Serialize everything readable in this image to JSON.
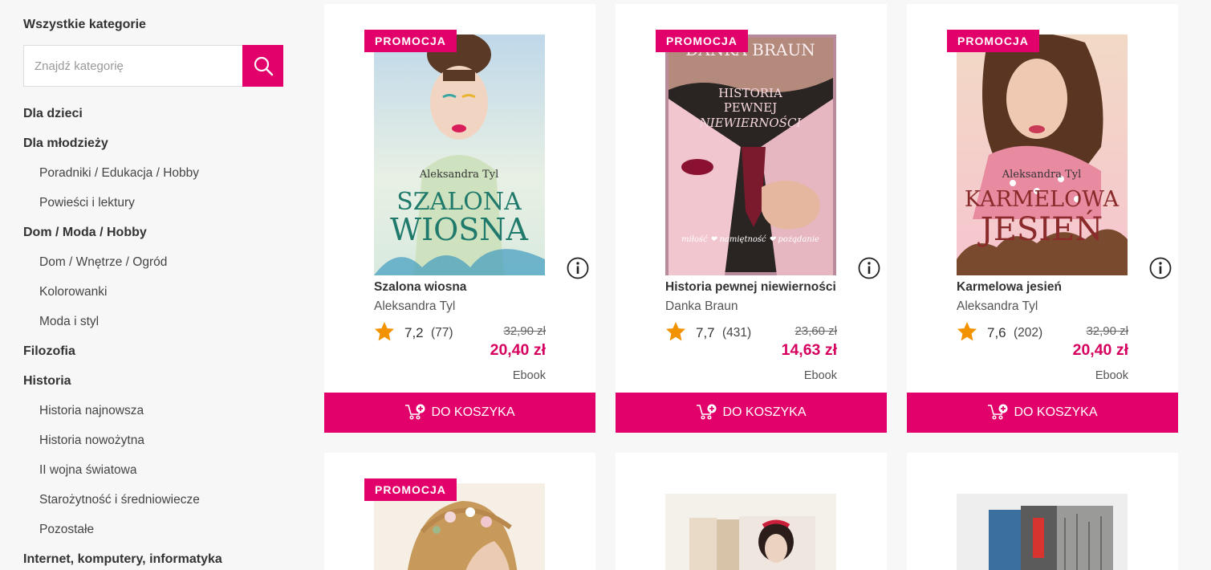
{
  "sidebar": {
    "title": "Wszystkie kategorie",
    "search_placeholder": "Znajdź kategorię",
    "categories": [
      {
        "label": "Dla dzieci",
        "level": "top"
      },
      {
        "label": "Dla młodzieży",
        "level": "top"
      },
      {
        "label": "Poradniki / Edukacja / Hobby",
        "level": "sub"
      },
      {
        "label": "Powieści i lektury",
        "level": "sub"
      },
      {
        "label": "Dom / Moda / Hobby",
        "level": "top"
      },
      {
        "label": "Dom / Wnętrze / Ogród",
        "level": "sub"
      },
      {
        "label": "Kolorowanki",
        "level": "sub"
      },
      {
        "label": "Moda i styl",
        "level": "sub"
      },
      {
        "label": "Filozofia",
        "level": "top"
      },
      {
        "label": "Historia",
        "level": "top"
      },
      {
        "label": "Historia najnowsza",
        "level": "sub"
      },
      {
        "label": "Historia nowożytna",
        "level": "sub"
      },
      {
        "label": "II wojna światowa",
        "level": "sub"
      },
      {
        "label": "Starożytność i średniowiecze",
        "level": "sub"
      },
      {
        "label": "Pozostałe",
        "level": "sub"
      },
      {
        "label": "Internet, komputery, informatyka",
        "level": "top"
      }
    ]
  },
  "products": [
    {
      "badge": "PROMOCJA",
      "title": "Szalona wiosna",
      "author": "Aleksandra Tyl",
      "rating": "7,2",
      "votes": "(77)",
      "old_price": "32,90 zł",
      "new_price": "20,40 zł",
      "format": "Ebook",
      "cart_label": "DO KOSZYKA",
      "cover": {
        "author": "Aleksandra Tyl",
        "line1": "SZALONA",
        "line2": "WIOSNA"
      }
    },
    {
      "badge": "PROMOCJA",
      "title": "Historia pewnej niewierności",
      "author": "Danka Braun",
      "rating": "7,7",
      "votes": "(431)",
      "old_price": "23,60 zł",
      "new_price": "14,63 zł",
      "format": "Ebook",
      "cart_label": "DO KOSZYKA",
      "cover": {
        "author": "DANKA BRAUN",
        "line1": "HISTORIA",
        "line2": "PEWNEJ",
        "line3": "NIEWIERNOŚCI",
        "tagline": "miłość ❤ namiętność ❤ pożądanie"
      }
    },
    {
      "badge": "PROMOCJA",
      "title": "Karmelowa jesień",
      "author": "Aleksandra Tyl",
      "rating": "7,6",
      "votes": "(202)",
      "old_price": "32,90 zł",
      "new_price": "20,40 zł",
      "format": "Ebook",
      "cart_label": "DO KOSZYKA",
      "cover": {
        "author": "Aleksandra Tyl",
        "line1": "KARMELOWA",
        "line2": "JESIEŃ"
      }
    }
  ],
  "products_row2": [
    {
      "badge": "PROMOCJA"
    }
  ],
  "colors": {
    "accent": "#e2006b",
    "price": "#d6005f",
    "star": "#f39200"
  }
}
